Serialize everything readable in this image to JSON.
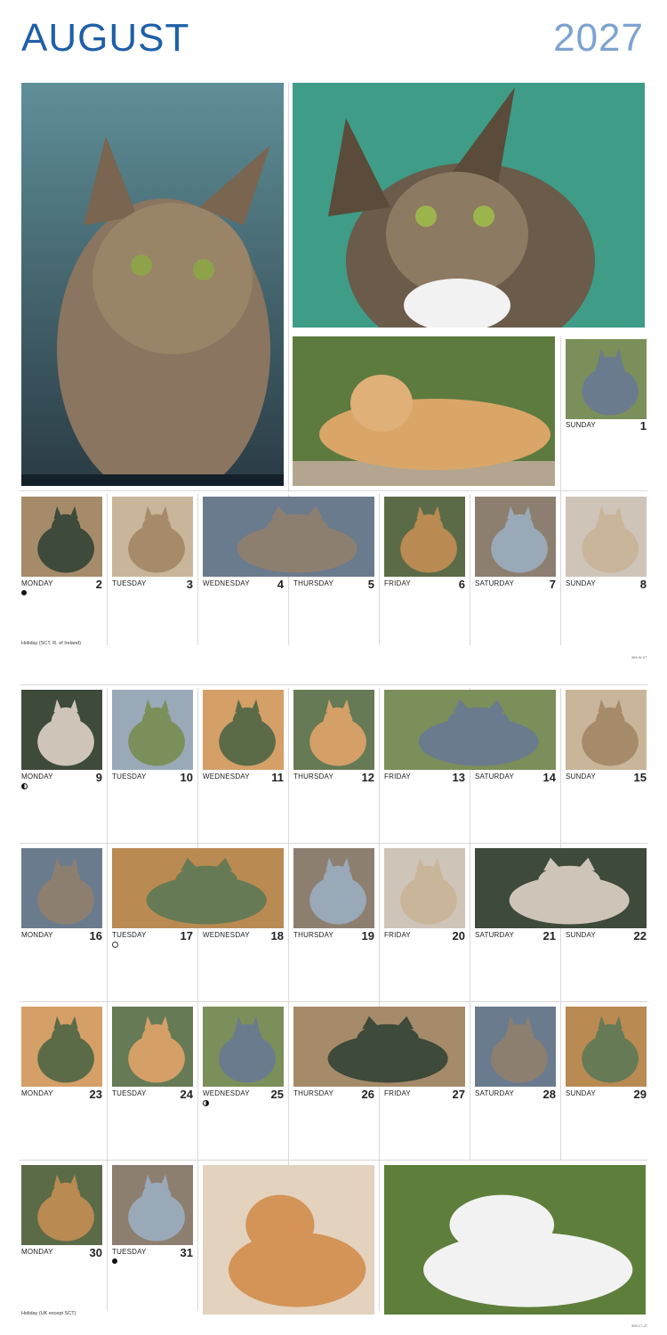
{
  "header": {
    "month": "AUGUST",
    "year": "2027"
  },
  "days": [
    {
      "name": "SUNDAY",
      "num": "1"
    },
    {
      "name": "MONDAY",
      "num": "2",
      "moon": "new"
    },
    {
      "name": "TUESDAY",
      "num": "3"
    },
    {
      "name": "WEDNESDAY",
      "num": "4"
    },
    {
      "name": "THURSDAY",
      "num": "5"
    },
    {
      "name": "FRIDAY",
      "num": "6"
    },
    {
      "name": "SATURDAY",
      "num": "7"
    },
    {
      "name": "SUNDAY",
      "num": "8"
    },
    {
      "name": "MONDAY",
      "num": "9",
      "moon": "half-l"
    },
    {
      "name": "TUESDAY",
      "num": "10"
    },
    {
      "name": "WEDNESDAY",
      "num": "11"
    },
    {
      "name": "THURSDAY",
      "num": "12"
    },
    {
      "name": "FRIDAY",
      "num": "13"
    },
    {
      "name": "SATURDAY",
      "num": "14"
    },
    {
      "name": "SUNDAY",
      "num": "15"
    },
    {
      "name": "MONDAY",
      "num": "16"
    },
    {
      "name": "TUESDAY",
      "num": "17",
      "moon": "full"
    },
    {
      "name": "WEDNESDAY",
      "num": "18"
    },
    {
      "name": "THURSDAY",
      "num": "19"
    },
    {
      "name": "FRIDAY",
      "num": "20"
    },
    {
      "name": "SATURDAY",
      "num": "21"
    },
    {
      "name": "SUNDAY",
      "num": "22"
    },
    {
      "name": "MONDAY",
      "num": "23"
    },
    {
      "name": "TUESDAY",
      "num": "24"
    },
    {
      "name": "WEDNESDAY",
      "num": "25",
      "moon": "half-r"
    },
    {
      "name": "THURSDAY",
      "num": "26"
    },
    {
      "name": "FRIDAY",
      "num": "27"
    },
    {
      "name": "SATURDAY",
      "num": "28"
    },
    {
      "name": "SUNDAY",
      "num": "29"
    },
    {
      "name": "MONDAY",
      "num": "30"
    },
    {
      "name": "TUESDAY",
      "num": "31",
      "moon": "new"
    }
  ],
  "holidays": {
    "week1": "Holiday (SCT, R. of Ireland)",
    "week5": "Holiday (UK except SCT)"
  },
  "codes": {
    "page1": "365 W-27",
    "page2": "365 17-27"
  }
}
